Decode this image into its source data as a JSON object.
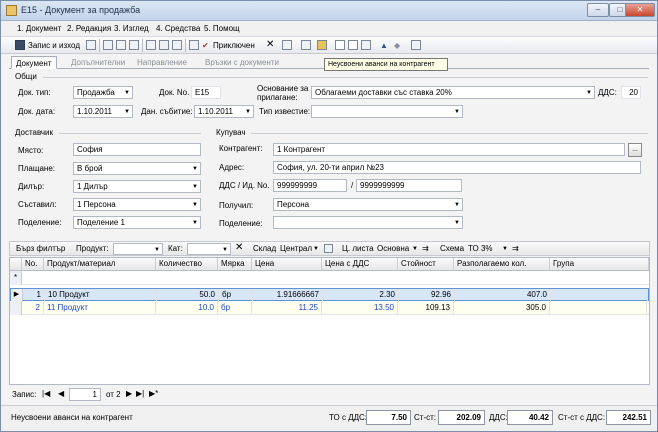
{
  "window": {
    "title": "E15 - Документ за продажба",
    "btn_minimize": "–",
    "btn_maximize": "□",
    "btn_close": "✕"
  },
  "menu": [
    "1. Документ",
    "2. Редакция",
    "3. Изглед",
    "4. Средства",
    "5. Помощ"
  ],
  "toolbar": {
    "save_exit": "Запис и изход",
    "post": "Приключен",
    "tooltip": "Неусвоени аванси на контрагент"
  },
  "tabs": [
    "Документ",
    "Допълнителни",
    "Направление",
    "Връзки с документи"
  ],
  "general": {
    "title": "Общи",
    "doc_type_label": "Док. тип:",
    "doc_type": "Продажба",
    "doc_no_label": "Док. No.",
    "doc_no": "E15",
    "basis_label": "Основание за прилагане:",
    "basis": "Облагаеми доставки със ставка 20%",
    "vat_label": "ДДС:",
    "vat": "20",
    "doc_date_label": "Док. дата:",
    "doc_date": "1.10.2011",
    "tax_date_label": "Дан. събитие:",
    "tax_date": "1.10.2011",
    "notice_type_label": "Тип известие:",
    "notice_type": ""
  },
  "supplier": {
    "title": "Доставчик",
    "place_label": "Място:",
    "place": "София",
    "payment_label": "Плащане:",
    "payment": "В брой",
    "dealer_label": "Дилър:",
    "dealer": "1 Дилър",
    "compiler_label": "Съставил:",
    "compiler": "1 Персона",
    "division_label": "Поделение:",
    "division": "Поделение 1"
  },
  "buyer": {
    "title": "Купувач",
    "contractor_label": "Контрагент:",
    "contractor": "1 Контрагент",
    "contractor_btn": "...",
    "address_label": "Адрес:",
    "address": "София, ул. 20-ти април №23",
    "vat_id_label": "ДДС / Ид. No.",
    "vat_no": "999999999",
    "id_sep": "/",
    "id_no": "9999999999",
    "receiver_label": "Получил:",
    "receiver": "Персона",
    "division_label": "Поделение:",
    "division": ""
  },
  "filter": {
    "quick": "Бърз филтър",
    "product": "Продукт:",
    "cat": "Кат:",
    "warehouse_label": "Склад",
    "warehouse": "Централ",
    "pricelist_label": "Ц. листа",
    "pricelist": "Основна",
    "scheme_label": "Схема",
    "scheme": "ТО 3%"
  },
  "grid": {
    "columns": [
      "No.",
      "Продукт/материал",
      "Количество",
      "Мярка",
      "Цена",
      "Цена с ДДС",
      "Стойност",
      "Разполагаемо кол.",
      "Група"
    ],
    "new_row_marker": "*",
    "rows": [
      {
        "no": "1",
        "product": "10 Продукт",
        "qty": "50.0",
        "unit": "бр",
        "price": "1.91666667",
        "price_vat": "2.30",
        "value": "92.96",
        "available": "407.0",
        "group": ""
      },
      {
        "no": "2",
        "product": "11 Продукт",
        "qty": "10.0",
        "unit": "бр",
        "price": "11.25",
        "price_vat": "13.50",
        "value": "109.13",
        "available": "305.0",
        "group": ""
      }
    ]
  },
  "nav": {
    "label": "Запис:",
    "current": "1",
    "of": "от 2"
  },
  "status": {
    "message": "Неусвоени аванси на контрагент",
    "to_vat_label": "ТО с ДДС:",
    "to_vat": "7.50",
    "total_label": "Ст-ст:",
    "total": "202.09",
    "vat_label": "ДДС:",
    "vat": "40.42",
    "total_vat_label": "Ст-ст с ДДС:",
    "total_vat": "242.51"
  },
  "colors": {
    "selected_row": "#d7e7f8",
    "new_row_text": "#1f48c9"
  }
}
